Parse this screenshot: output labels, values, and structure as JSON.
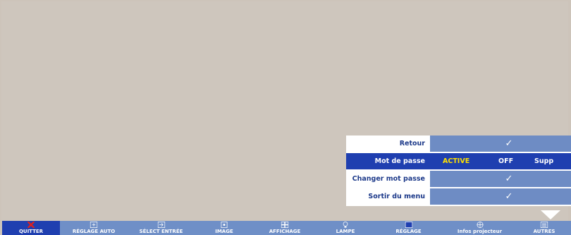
{
  "submenu": {
    "rows": [
      {
        "label": "Retour",
        "value": "✓"
      },
      {
        "label": "Mot de passe",
        "options": [
          "ACTIVE",
          "OFF",
          "Supp"
        ]
      },
      {
        "label": "Changer mot passe",
        "value": "✓"
      },
      {
        "label": "Sortir du menu",
        "value": "✓"
      }
    ]
  },
  "toolbar": {
    "items": [
      {
        "label": "QUITTER",
        "icon": "close-x-icon"
      },
      {
        "label": "RÉGLAGE AUTO",
        "icon": "auto-adjust-icon"
      },
      {
        "label": "SÉLECT ENTRÉE",
        "icon": "input-select-icon"
      },
      {
        "label": "IMAGE",
        "icon": "image-icon"
      },
      {
        "label": "AFFICHAGE",
        "icon": "display-icon"
      },
      {
        "label": "LAMPE",
        "icon": "lamp-icon"
      },
      {
        "label": "RÉGLAGE",
        "icon": "setup-icon"
      },
      {
        "label": "Infos projecteur",
        "icon": "projector-info-icon"
      },
      {
        "label": "AUTRES",
        "icon": "others-icon"
      }
    ]
  },
  "colors": {
    "selected": "#1f3fb0",
    "toolbar": "#6f8fc7",
    "label_text": "#1d3a8a",
    "active_option": "#ffe100",
    "quit_icon": "#e0211b"
  }
}
